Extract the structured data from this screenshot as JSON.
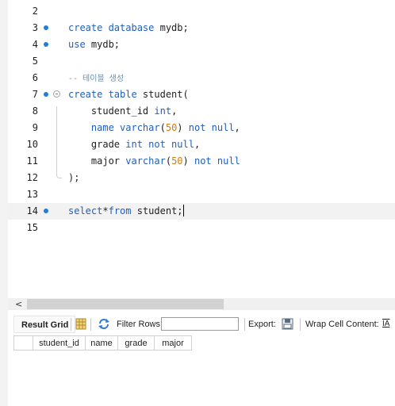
{
  "editor": {
    "lines": [
      {
        "num": "2",
        "marker": false,
        "segments": []
      },
      {
        "num": "3",
        "marker": true,
        "segments": [
          {
            "t": "create database ",
            "c": "kw"
          },
          {
            "t": "mydb;",
            "c": ""
          }
        ]
      },
      {
        "num": "4",
        "marker": true,
        "segments": [
          {
            "t": "use ",
            "c": "kw"
          },
          {
            "t": "mydb;",
            "c": ""
          }
        ]
      },
      {
        "num": "5",
        "marker": false,
        "segments": []
      },
      {
        "num": "6",
        "marker": false,
        "segments": [
          {
            "t": "-- 테이블 생성",
            "c": "cm"
          }
        ]
      },
      {
        "num": "7",
        "marker": true,
        "fold": true,
        "segments": [
          {
            "t": "create table ",
            "c": "kw"
          },
          {
            "t": "student(",
            "c": ""
          }
        ]
      },
      {
        "num": "8",
        "marker": false,
        "segments": [
          {
            "t": "    student_id ",
            "c": ""
          },
          {
            "t": "int",
            "c": "kw"
          },
          {
            "t": ",",
            "c": ""
          }
        ]
      },
      {
        "num": "9",
        "marker": false,
        "segments": [
          {
            "t": "    ",
            "c": ""
          },
          {
            "t": "name varchar",
            "c": "kw"
          },
          {
            "t": "(",
            "c": ""
          },
          {
            "t": "50",
            "c": "num"
          },
          {
            "t": ") ",
            "c": ""
          },
          {
            "t": "not null",
            "c": "kw"
          },
          {
            "t": ",",
            "c": ""
          }
        ]
      },
      {
        "num": "10",
        "marker": false,
        "segments": [
          {
            "t": "    grade ",
            "c": ""
          },
          {
            "t": "int not null",
            "c": "kw"
          },
          {
            "t": ",",
            "c": ""
          }
        ]
      },
      {
        "num": "11",
        "marker": false,
        "segments": [
          {
            "t": "    major ",
            "c": ""
          },
          {
            "t": "varchar",
            "c": "kw"
          },
          {
            "t": "(",
            "c": ""
          },
          {
            "t": "50",
            "c": "num"
          },
          {
            "t": ") ",
            "c": ""
          },
          {
            "t": "not null",
            "c": "kw"
          }
        ]
      },
      {
        "num": "12",
        "marker": false,
        "segments": [
          {
            "t": ");",
            "c": ""
          }
        ]
      },
      {
        "num": "13",
        "marker": false,
        "segments": []
      },
      {
        "num": "14",
        "marker": true,
        "active": true,
        "cursor": true,
        "segments": [
          {
            "t": "select",
            "c": "kw"
          },
          {
            "t": "*",
            "c": ""
          },
          {
            "t": "from ",
            "c": "kw"
          },
          {
            "t": "student;",
            "c": ""
          }
        ]
      },
      {
        "num": "15",
        "marker": false,
        "segments": []
      }
    ]
  },
  "scrollbar": {
    "left_arrow": "<"
  },
  "result_toolbar": {
    "result_grid_label": "Result Grid",
    "filter_rows_label": "Filter Rows:",
    "filter_value": "",
    "export_label": "Export:",
    "wrap_label": "Wrap Cell Content:",
    "wrap_icon_text": "IA"
  },
  "result_grid": {
    "columns": [
      "student_id",
      "name",
      "grade",
      "major"
    ]
  },
  "colors": {
    "keyword": "#1f5fbf",
    "number": "#d27b13",
    "comment": "#6a8fb0",
    "marker": "#1e7ed9"
  }
}
